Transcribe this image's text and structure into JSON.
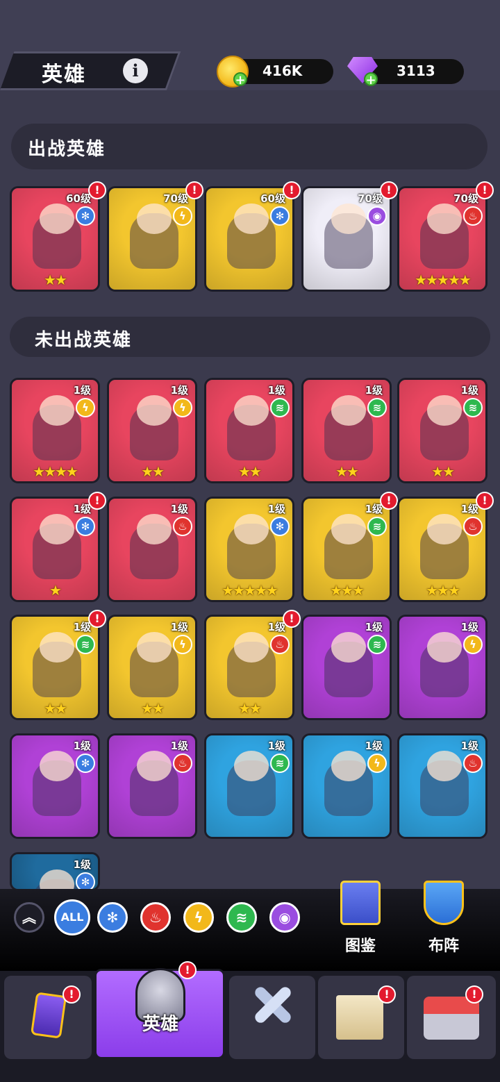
{
  "header": {
    "title": "英雄",
    "coins": "416K",
    "gems": "3113"
  },
  "sections": {
    "active_title": "出战英雄",
    "inactive_title": "未出战英雄"
  },
  "active_heroes": [
    {
      "level": "60级",
      "element": "frost",
      "stars": "★★",
      "alert": true,
      "color": "#e8455f"
    },
    {
      "level": "70级",
      "element": "lightning",
      "stars": "",
      "alert": true,
      "color": "#f3c62e"
    },
    {
      "level": "60级",
      "element": "frost",
      "stars": "",
      "alert": true,
      "color": "#f3c62e"
    },
    {
      "level": "70级",
      "element": "eye",
      "stars": "",
      "alert": true,
      "color": "#f0eef8"
    },
    {
      "level": "70级",
      "element": "fire",
      "stars": "★★★★★",
      "alert": true,
      "color": "#e8455f"
    }
  ],
  "inactive_heroes": [
    {
      "level": "1级",
      "element": "lightning",
      "stars": "★★★★",
      "alert": false,
      "color": "#e8455f"
    },
    {
      "level": "1级",
      "element": "lightning",
      "stars": "★★",
      "alert": false,
      "color": "#e8455f"
    },
    {
      "level": "1级",
      "element": "wind",
      "stars": "★★",
      "alert": false,
      "color": "#e8455f"
    },
    {
      "level": "1级",
      "element": "wind",
      "stars": "★★",
      "alert": false,
      "color": "#e8455f"
    },
    {
      "level": "1级",
      "element": "wind",
      "stars": "★★",
      "alert": false,
      "color": "#e8455f"
    },
    {
      "level": "1级",
      "element": "frost",
      "stars": "★",
      "alert": true,
      "color": "#e8455f"
    },
    {
      "level": "1级",
      "element": "fire",
      "stars": "",
      "alert": false,
      "color": "#e8455f"
    },
    {
      "level": "1级",
      "element": "frost",
      "stars": "★★★★★",
      "alert": false,
      "color": "#f3c62e"
    },
    {
      "level": "1级",
      "element": "wind",
      "stars": "★★★",
      "alert": true,
      "color": "#f3c62e"
    },
    {
      "level": "1级",
      "element": "fire",
      "stars": "★★★",
      "alert": true,
      "color": "#f3c62e"
    },
    {
      "level": "1级",
      "element": "wind",
      "stars": "★★",
      "alert": true,
      "color": "#f3c62e"
    },
    {
      "level": "1级",
      "element": "lightning",
      "stars": "★★",
      "alert": false,
      "color": "#f3c62e"
    },
    {
      "level": "1级",
      "element": "fire",
      "stars": "★★",
      "alert": true,
      "color": "#f3c62e"
    },
    {
      "level": "1级",
      "element": "wind",
      "stars": "",
      "alert": false,
      "color": "#b041d6"
    },
    {
      "level": "1级",
      "element": "lightning",
      "stars": "",
      "alert": false,
      "color": "#b041d6"
    },
    {
      "level": "1级",
      "element": "frost",
      "stars": "",
      "alert": false,
      "color": "#b041d6"
    },
    {
      "level": "1级",
      "element": "fire",
      "stars": "",
      "alert": false,
      "color": "#b041d6"
    },
    {
      "level": "1级",
      "element": "wind",
      "stars": "",
      "alert": false,
      "color": "#2fa3e0"
    },
    {
      "level": "1级",
      "element": "lightning",
      "stars": "",
      "alert": false,
      "color": "#2fa3e0"
    },
    {
      "level": "1级",
      "element": "fire",
      "stars": "",
      "alert": false,
      "color": "#2fa3e0"
    },
    {
      "level": "1级",
      "element": "frost",
      "stars": "",
      "alert": false,
      "color": "#1f6b9e"
    }
  ],
  "filters": [
    "collapse",
    "ALL",
    "frost",
    "fire",
    "lightning",
    "wind",
    "eye"
  ],
  "filter_all_label": "ALL",
  "side_buttons": {
    "codex_label": "图鉴",
    "formation_label": "布阵"
  },
  "nav": {
    "heroes_label": "英雄"
  },
  "element_colors": {
    "frost": "#3b7de0",
    "lightning": "#f2b81a",
    "wind": "#2eb84f",
    "fire": "#e0332e",
    "eye": "#9a4de0"
  },
  "element_glyphs": {
    "frost": "✻",
    "lightning": "ϟ",
    "wind": "≋",
    "fire": "♨",
    "eye": "◉",
    "collapse": "︽"
  }
}
